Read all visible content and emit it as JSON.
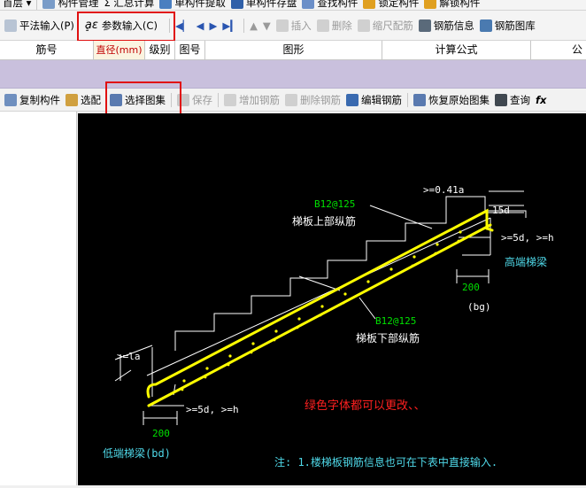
{
  "toolbar1": {
    "floor": "首层",
    "items": [
      "构件管理",
      "Σ 汇总计算",
      "单构件提取",
      "单构件存盘",
      "查找构件",
      "锁定构件",
      "解锁构件"
    ]
  },
  "toolbar2": {
    "flat_input": "平法输入(P)",
    "param_input": "参数输入(C)",
    "insert": "插入",
    "delete": "删除",
    "scale_rebar": "缩尺配筋",
    "rebar_info": "钢筋信息",
    "rebar_layout": "钢筋图库"
  },
  "grid_header": {
    "columns": [
      "筋号",
      "直径(mm)",
      "级别",
      "图号",
      "图形",
      "计算公式",
      "公"
    ]
  },
  "toolbar3": {
    "copy_component": "复制构件",
    "select_config": "选配",
    "select_atlas": "选择图集",
    "save": "保存",
    "add_rebar": "增加钢筋",
    "delete_rebar": "删除钢筋",
    "edit_rebar": "编辑钢筋",
    "restore_atlas": "恢复原始图集",
    "query": "查询",
    "fx": "fx"
  },
  "drawing": {
    "label_041la": ">=0.41a",
    "label_15d": "15d",
    "upper_spec": "B12@125",
    "upper_name": "梯板上部纵筋",
    "label_5d_h_top": ">=5d, >=h",
    "high_beam": "高端梯梁",
    "dim_200_top": "200",
    "bg": "(bg)",
    "lower_spec": "B12@125",
    "lower_name": "梯板下部纵筋",
    "label_la": ">=la",
    "label_5d_h_bottom": ">=5d, >=h",
    "dim_200_bottom": "200",
    "low_beam": "低端梯梁(bd)",
    "green_note": "绿色字体都可以更改、、",
    "footnote": "注: 1.楼梯板钢筋信息也可在下表中直接输入."
  },
  "colors": {
    "canvas_bg": "#000000",
    "rebar": "#ffff00",
    "green_text": "#00e000",
    "cyan_text": "#4fd8e8",
    "red_note": "#ff2020",
    "highlight_box": "#e01010"
  }
}
